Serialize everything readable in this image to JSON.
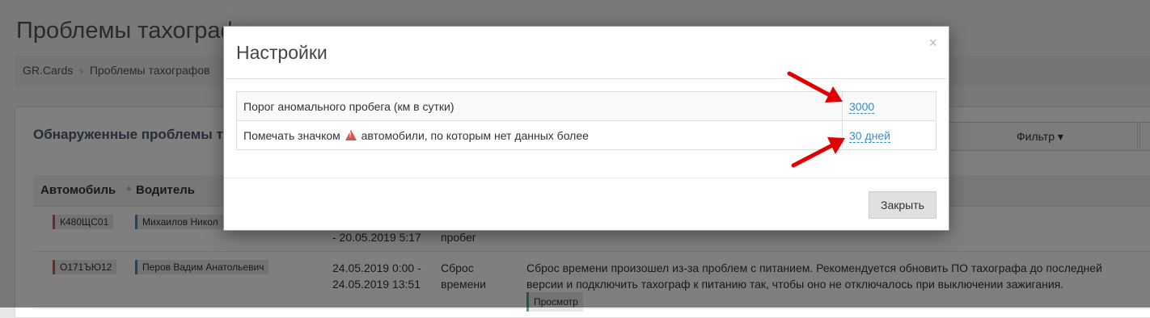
{
  "page": {
    "title": "Проблемы тахографов",
    "breadcrumb": [
      "GR.Cards",
      "Проблемы тахографов"
    ],
    "panel_title": "Обнаруженные проблемы т",
    "filter_label": "Фильтр ▾"
  },
  "table": {
    "headers": [
      "Автомобиль",
      "Водитель"
    ],
    "rows": [
      {
        "car": "К480ЩС01",
        "driver": "Михаилов Никол",
        "period_tail": "- 20.05.2019 5:17",
        "type_tail": "пробег"
      },
      {
        "car": "О171ЪЮ12",
        "driver": "Перов Вадим Анатольевич",
        "period": "24.05.2019 0:00 -\n24.05.2019 13:51",
        "type": "Сброс\nвремени",
        "description": "Сброс времени произошел из-за проблем с питанием. Рекомендуется обновить ПО тахографа до последней версии и подключить тахограф к питанию так, чтобы оно не отключалось при выключении зажигания.",
        "action": "Просмотр"
      }
    ]
  },
  "modal": {
    "title": "Настройки",
    "close_x": "×",
    "settings": [
      {
        "label": "Порог аномального пробега (км в сутки)",
        "value": "3000"
      },
      {
        "label_before": "Помечать значком",
        "label_after": "автомобили, по которым нет данных более",
        "value": "30 дней"
      }
    ],
    "close_button": "Закрыть"
  },
  "colors": {
    "link": "#3c8dbc",
    "warning": "#d9534f",
    "arrow": "#e00000"
  }
}
